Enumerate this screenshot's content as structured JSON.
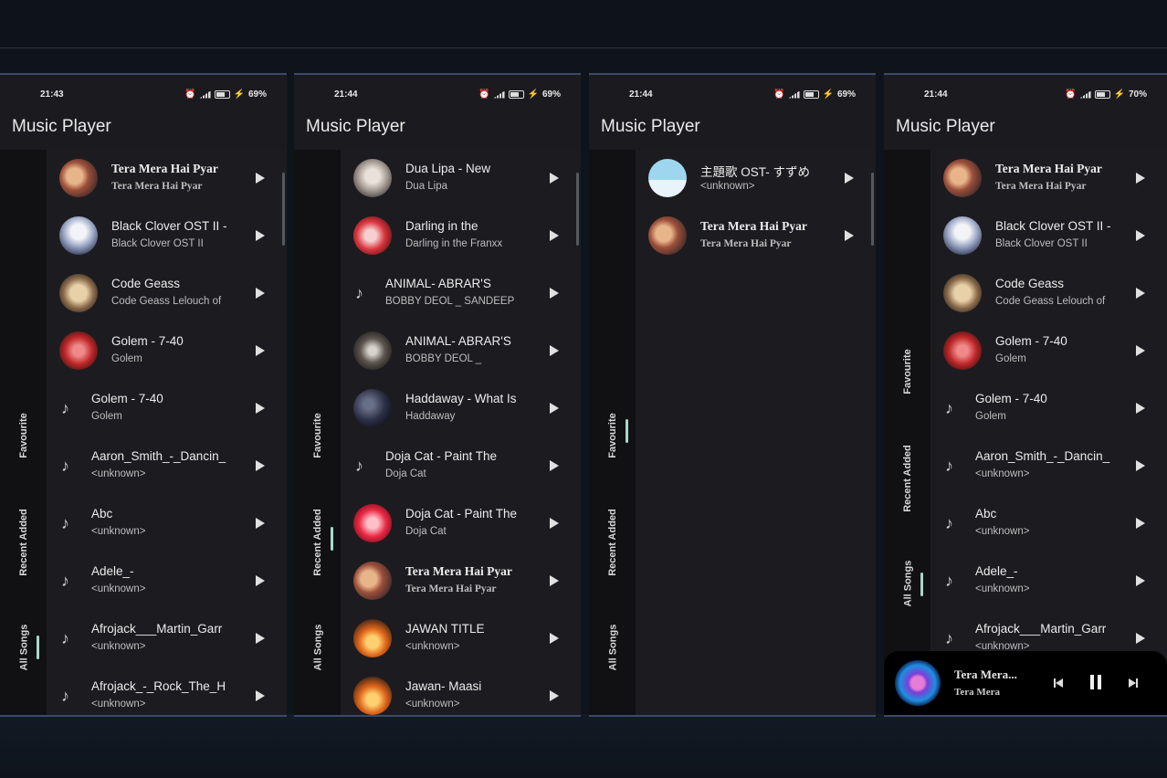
{
  "screens": [
    {
      "time": "21:43",
      "battery": "69%",
      "title": "Music Player",
      "tabs": [
        "Favourite",
        "Recent Added",
        "All Songs"
      ],
      "songs": [
        {
          "title": "Tera Mera Hai Pyar",
          "subtitle": "Tera Mera Hai Pyar",
          "art": "art-warm",
          "serif": true
        },
        {
          "title": "Black Clover OST II -",
          "subtitle": "Black Clover OST II",
          "art": "art-anime"
        },
        {
          "title": "Code Geass",
          "subtitle": "Code Geass Lelouch of",
          "art": "art-cream"
        },
        {
          "title": "Golem - 7-40",
          "subtitle": "Golem",
          "art": "art-red"
        },
        {
          "title": "Golem - 7-40",
          "subtitle": "Golem",
          "art": "note"
        },
        {
          "title": "Aaron_Smith_-_Dancin_",
          "subtitle": "<unknown>",
          "art": "note"
        },
        {
          "title": "Abc",
          "subtitle": "<unknown>",
          "art": "note"
        },
        {
          "title": "Adele_-",
          "subtitle": "<unknown>",
          "art": "note"
        },
        {
          "title": "Afrojack___Martin_Garr",
          "subtitle": "<unknown>",
          "art": "note"
        },
        {
          "title": "Afrojack_-_Rock_The_H",
          "subtitle": "<unknown>",
          "art": "note"
        }
      ]
    },
    {
      "time": "21:44",
      "battery": "69%",
      "title": "Music Player",
      "tabs": [
        "Favourite",
        "Recent Added",
        "All Songs"
      ],
      "songs": [
        {
          "title": "Dua Lipa - New",
          "subtitle": "Dua Lipa",
          "art": "art-grey"
        },
        {
          "title": "Darling in the",
          "subtitle": "Darling in the Franxx",
          "art": "art-pink"
        },
        {
          "title": "ANIMAL- ABRAR'S",
          "subtitle": "BOBBY DEOL _ SANDEEP",
          "art": "note"
        },
        {
          "title": "ANIMAL- ABRAR'S",
          "subtitle": "BOBBY DEOL _",
          "art": "art-dark"
        },
        {
          "title": "Haddaway - What Is",
          "subtitle": "Haddaway",
          "art": "art-night"
        },
        {
          "title": "Doja Cat - Paint The",
          "subtitle": "Doja Cat",
          "art": "note"
        },
        {
          "title": "Doja Cat - Paint The",
          "subtitle": "Doja Cat",
          "art": "art-doja"
        },
        {
          "title": "Tera Mera Hai Pyar",
          "subtitle": "Tera Mera Hai Pyar",
          "art": "art-warm",
          "serif": true
        },
        {
          "title": "JAWAN TITLE",
          "subtitle": "<unknown>",
          "art": "art-fire"
        },
        {
          "title": "Jawan- Maasi",
          "subtitle": "<unknown>",
          "art": "art-fire"
        }
      ]
    },
    {
      "time": "21:44",
      "battery": "69%",
      "title": "Music Player",
      "tabs": [
        "Favourite",
        "Recent Added",
        "All Songs"
      ],
      "songs": [
        {
          "title": "主題歌 OST- すずめ",
          "subtitle": "<unknown>",
          "art": "art-sky"
        },
        {
          "title": "Tera Mera Hai Pyar",
          "subtitle": "Tera Mera Hai Pyar",
          "art": "art-warm",
          "serif": true
        }
      ]
    },
    {
      "time": "21:44",
      "battery": "70%",
      "title": "Music Player",
      "tabs": [
        "Favourite",
        "Recent Added",
        "All Songs"
      ],
      "songs": [
        {
          "title": "Tera Mera Hai Pyar",
          "subtitle": "Tera Mera Hai Pyar",
          "art": "art-warm",
          "serif": true
        },
        {
          "title": "Black Clover OST II -",
          "subtitle": "Black Clover OST II",
          "art": "art-anime"
        },
        {
          "title": "Code Geass",
          "subtitle": "Code Geass Lelouch of",
          "art": "art-cream"
        },
        {
          "title": "Golem - 7-40",
          "subtitle": "Golem",
          "art": "art-red"
        },
        {
          "title": "Golem - 7-40",
          "subtitle": "Golem",
          "art": "note"
        },
        {
          "title": "Aaron_Smith_-_Dancin_",
          "subtitle": "<unknown>",
          "art": "note"
        },
        {
          "title": "Abc",
          "subtitle": "<unknown>",
          "art": "note"
        },
        {
          "title": "Adele_-",
          "subtitle": "<unknown>",
          "art": "note"
        },
        {
          "title": "Afrojack___Martin_Garr",
          "subtitle": "<unknown>",
          "art": "note"
        }
      ],
      "now_playing": {
        "title": "Tera Mera...",
        "subtitle": "Tera Mera"
      }
    }
  ],
  "colors": {
    "background": "#0f141c",
    "panel": "#1c1c20",
    "rail": "#111114",
    "indicator": "#a8d8c8",
    "frame": "#3b4a6a"
  }
}
